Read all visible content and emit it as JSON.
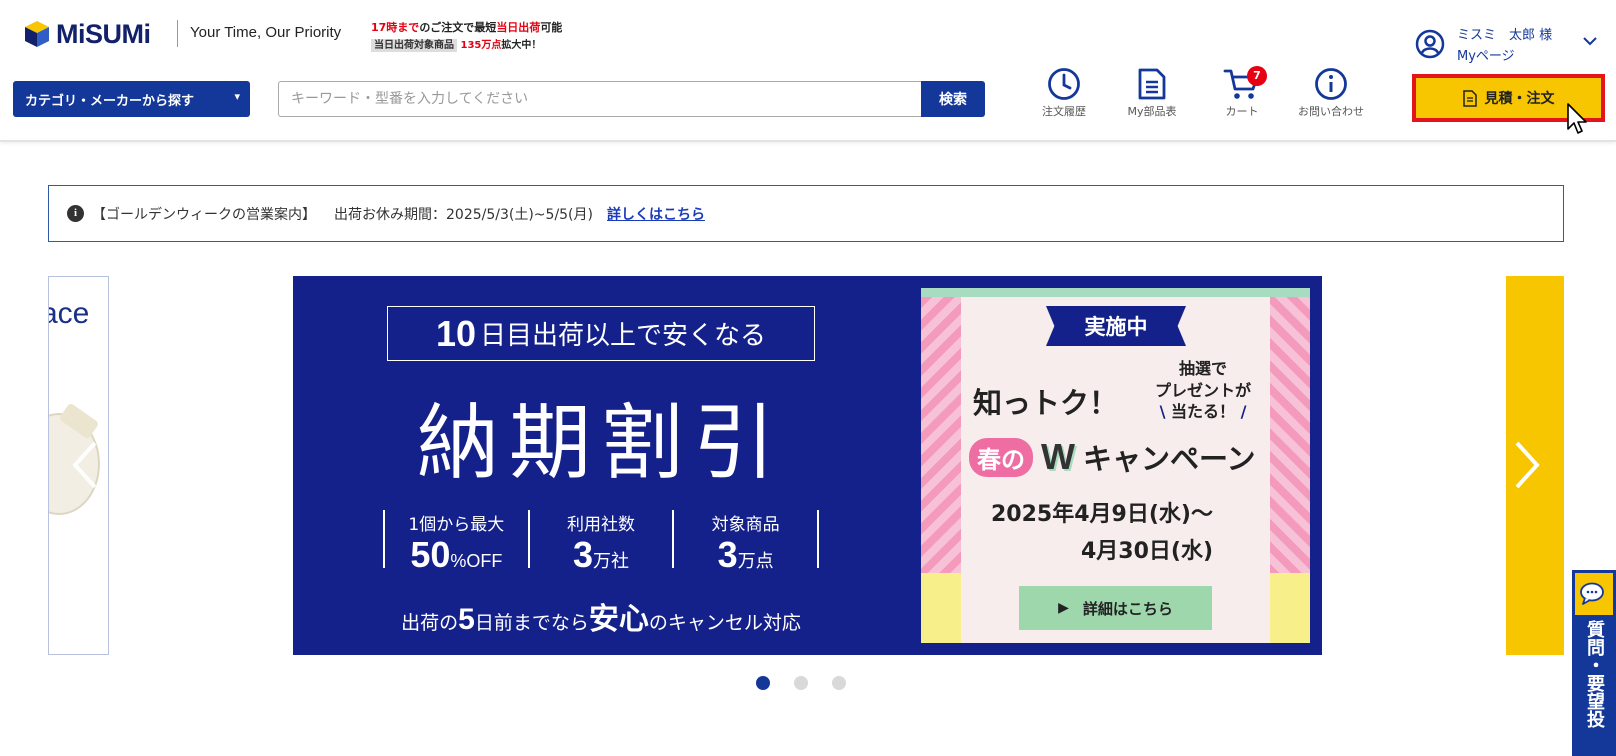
{
  "header": {
    "logo_text": "MiSUMi",
    "tagline": "Your Time, Our Priority",
    "promo_line1": {
      "red1": "17時まで",
      "mid": "のご注文で最短",
      "red2": "当日出荷",
      "end": "可能"
    },
    "promo_line2": {
      "tag": "当日出荷対象商品",
      "red": "135万点",
      "end": "拡大中！"
    },
    "category_button": "カテゴリ・メーカーから探す",
    "search_placeholder": "キーワード・型番を入力してください",
    "search_button": "検索",
    "nav": {
      "order_history": "注文履歴",
      "my_parts": "My部品表",
      "cart": "カート",
      "cart_count": "7",
      "inquiry": "お問い合わせ"
    },
    "user_name": "ミスミ　太郎 様",
    "my_page": "Myページ",
    "quote_order_button": "見積・注文"
  },
  "notice": {
    "title": "【ゴールデンウィークの営業案内】",
    "text": "出荷お休み期間：2025/5/3(土)~5/5(月)",
    "link": "詳しくはこちら"
  },
  "carousel": {
    "left_partial_text": "ace",
    "banner": {
      "sub_num": "10",
      "sub_text": "日目出荷以上で安くなる",
      "main": "納期割引",
      "stats": [
        {
          "label": "1個から最大",
          "value": "50",
          "unit": "%OFF"
        },
        {
          "label": "利用社数",
          "value": "3",
          "unit": "万社"
        },
        {
          "label": "対象商品",
          "value": "3",
          "unit": "万点"
        }
      ],
      "foot_pre": "出荷の",
      "foot_num": "5",
      "foot_mid": "日前までなら",
      "foot_big": "安心",
      "foot_end": "のキャンセル対応"
    },
    "campaign": {
      "ribbon": "実施中",
      "title": "知っトク！",
      "lottery_line1": "抽選で",
      "lottery_line2": "プレゼントが",
      "lottery_line3": "当たる！",
      "haru": "春の",
      "w": "W",
      "rest": "キャンペーン",
      "date1": "2025年4月9日(水)～",
      "date2": "4月30日(水)",
      "button": "詳細はこちら"
    },
    "dots": [
      "1",
      "2",
      "3"
    ]
  },
  "chat_tab": "質問・要望投",
  "colors": {
    "brand_navy": "#13389a",
    "banner_navy": "#14218a",
    "accent_yellow": "#f7c600",
    "highlight_red": "#e2151d",
    "badge_red": "#e60012"
  }
}
